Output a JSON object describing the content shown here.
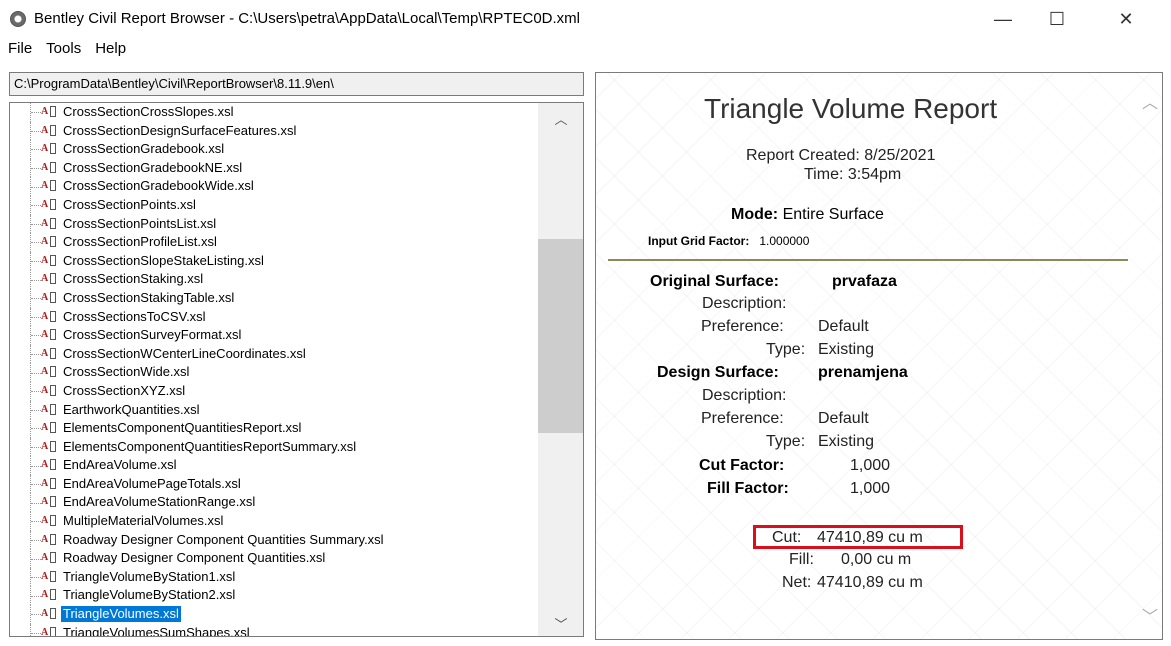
{
  "window": {
    "title": "Bentley Civil Report Browser - C:\\Users\\petra\\AppData\\Local\\Temp\\RPTEC0D.xml",
    "minimize": "—",
    "maximize": "☐",
    "close": "✕"
  },
  "menu": [
    "File",
    "Tools",
    "Help"
  ],
  "path": "C:\\ProgramData\\Bentley\\Civil\\ReportBrowser\\8.11.9\\en\\",
  "files": [
    "CrossSectionCrossSlopes.xsl",
    "CrossSectionDesignSurfaceFeatures.xsl",
    "CrossSectionGradebook.xsl",
    "CrossSectionGradebookNE.xsl",
    "CrossSectionGradebookWide.xsl",
    "CrossSectionPoints.xsl",
    "CrossSectionPointsList.xsl",
    "CrossSectionProfileList.xsl",
    "CrossSectionSlopeStakeListing.xsl",
    "CrossSectionStaking.xsl",
    "CrossSectionStakingTable.xsl",
    "CrossSectionsToCSV.xsl",
    "CrossSectionSurveyFormat.xsl",
    "CrossSectionWCenterLineCoordinates.xsl",
    "CrossSectionWide.xsl",
    "CrossSectionXYZ.xsl",
    "EarthworkQuantities.xsl",
    "ElementsComponentQuantitiesReport.xsl",
    "ElementsComponentQuantitiesReportSummary.xsl",
    "EndAreaVolume.xsl",
    "EndAreaVolumePageTotals.xsl",
    "EndAreaVolumeStationRange.xsl",
    "MultipleMaterialVolumes.xsl",
    "Roadway Designer Component Quantities Summary.xsl",
    "Roadway Designer Component Quantities.xsl",
    "TriangleVolumeByStation1.xsl",
    "TriangleVolumeByStation2.xsl",
    "TriangleVolumes.xsl",
    "TriangleVolumesSumShapes.xsl"
  ],
  "selected_file": "TriangleVolumes.xsl",
  "icons": {
    "file": "xsl-file-icon",
    "app": "app-icon"
  },
  "report": {
    "title": "Triangle Volume Report",
    "created": "Report Created:  8/25/2021",
    "time": "Time:  3:54pm",
    "mode_label": "Mode:",
    "mode_value": "Entire Surface",
    "grid_label": "Input Grid Factor:",
    "grid_value": "1.000000",
    "original_label": "Original Surface:",
    "original_value": "prvafaza",
    "desc_label": "Description:",
    "pref_label": "Preference:",
    "pref_value": "Default",
    "type_label": "Type:",
    "type_value": "Existing",
    "design_label": "Design Surface:",
    "design_value": "prenamjena",
    "desc2_label": "Description:",
    "pref2_label": "Preference:",
    "pref2_value": "Default",
    "type2_label": "Type:",
    "type2_value": "Existing",
    "cut_factor_label": "Cut Factor:",
    "cut_factor_value": "1,000",
    "fill_factor_label": "Fill Factor:",
    "fill_factor_value": "1,000",
    "cut_label": "Cut:",
    "cut_value": "47410,89 cu m",
    "fill_label": "Fill:",
    "fill_value": "0,00 cu m",
    "net_label": "Net:",
    "net_value": "47410,89 cu m",
    "highlight_color": "#d9101c"
  }
}
